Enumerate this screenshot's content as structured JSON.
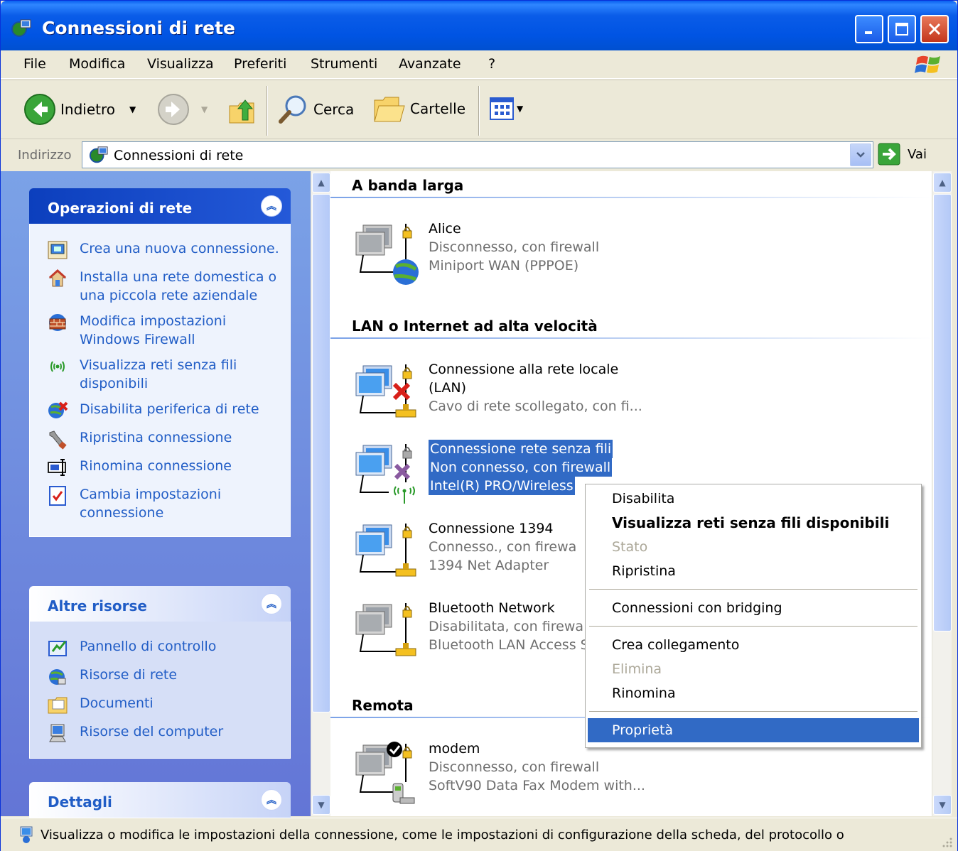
{
  "window": {
    "title": "Connessioni di rete"
  },
  "menubar": {
    "items": [
      "File",
      "Modifica",
      "Visualizza",
      "Preferiti",
      "Strumenti",
      "Avanzate",
      "?"
    ]
  },
  "toolbar": {
    "back_label": "Indietro",
    "search_label": "Cerca",
    "folders_label": "Cartelle"
  },
  "address": {
    "label": "Indirizzo",
    "value": "Connessioni di rete",
    "go_label": "Vai"
  },
  "left": {
    "network_tasks": {
      "title": "Operazioni di rete",
      "items": [
        {
          "label": "Crea una nuova connessione.",
          "icon": "new-connection-icon"
        },
        {
          "label": "Installa una rete domestica o una piccola rete aziendale",
          "icon": "home-network-icon"
        },
        {
          "label": "Modifica impostazioni Windows Firewall",
          "icon": "firewall-icon"
        },
        {
          "label": "Visualizza reti senza fili disponibili",
          "icon": "wireless-icon"
        },
        {
          "label": "Disabilita periferica di rete",
          "icon": "disable-device-icon"
        },
        {
          "label": "Ripristina connessione",
          "icon": "repair-icon"
        },
        {
          "label": "Rinomina connessione",
          "icon": "rename-icon"
        },
        {
          "label": "Cambia impostazioni connessione",
          "icon": "settings-icon"
        }
      ]
    },
    "other_places": {
      "title": "Altre risorse",
      "items": [
        {
          "label": "Pannello di controllo",
          "icon": "control-panel-icon"
        },
        {
          "label": "Risorse di rete",
          "icon": "network-places-icon"
        },
        {
          "label": "Documenti",
          "icon": "documents-icon"
        },
        {
          "label": "Risorse del computer",
          "icon": "my-computer-icon"
        }
      ]
    },
    "details": {
      "title": "Dettagli"
    }
  },
  "content": {
    "groups": [
      {
        "title": "A banda larga"
      },
      {
        "title": "LAN o Internet ad alta velocità"
      },
      {
        "title": "Remota"
      }
    ],
    "connections": [
      {
        "name": "Alice",
        "status": "Disconnesso, con firewall",
        "device": "Miniport WAN (PPPOE)"
      },
      {
        "name": "Connessione alla rete locale (LAN)",
        "name1": "Connessione alla rete locale",
        "name2": "(LAN)",
        "status": "Cavo di rete scollegato, con fi...",
        "device": ""
      },
      {
        "name": "Connessione rete senza fili",
        "status": "Non connesso, con firewall",
        "device": "Intel(R) PRO/Wireless",
        "selected": true
      },
      {
        "name": "Connessione 1394",
        "status": "Connesso., con firewa",
        "device": "1394 Net Adapter"
      },
      {
        "name": "Bluetooth Network",
        "status": "Disabilitata, con firewa",
        "device": "Bluetooth LAN Access S"
      },
      {
        "name": "modem",
        "status": "Disconnesso, con firewall",
        "device": "SoftV90 Data Fax Modem with..."
      }
    ]
  },
  "context_menu": {
    "items": [
      {
        "label": "Disabilita",
        "state": "normal"
      },
      {
        "label": "Visualizza reti senza fili disponibili",
        "state": "default"
      },
      {
        "label": "Stato",
        "state": "disabled"
      },
      {
        "label": "Ripristina",
        "state": "normal"
      },
      {
        "label": "Connessioni con bridging",
        "state": "normal"
      },
      {
        "label": "Crea collegamento",
        "state": "normal"
      },
      {
        "label": "Elimina",
        "state": "disabled"
      },
      {
        "label": "Rinomina",
        "state": "normal"
      },
      {
        "label": "Proprietà",
        "state": "highlighted"
      }
    ]
  },
  "status_bar": {
    "text": "Visualizza o modifica le impostazioni della connessione, come le impostazioni di configurazione della scheda, del protocollo o"
  },
  "colors": {
    "titlebar": "#0054e3",
    "selection": "#316ac5",
    "task_link": "#215dc6",
    "left_pane": "#7ba2e7"
  }
}
